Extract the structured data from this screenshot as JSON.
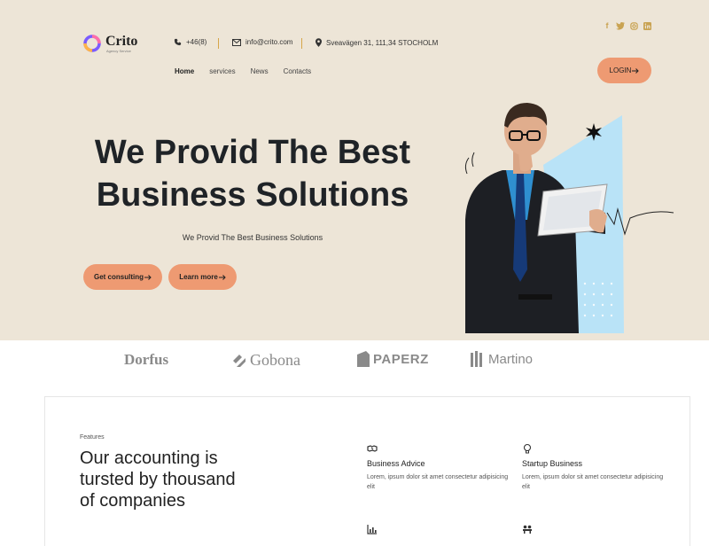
{
  "brand": {
    "name": "Crito",
    "tagline": "Agency Service"
  },
  "contact": {
    "phone": "+46(8)",
    "email": "info@crito.com",
    "address": "Sveavägen 31, 111,34 STOCHOLM"
  },
  "social": [
    {
      "name": "facebook",
      "glyph": "f"
    },
    {
      "name": "twitter",
      "glyph": "t"
    },
    {
      "name": "instagram",
      "glyph": "◎"
    },
    {
      "name": "linkedin",
      "glyph": "in"
    }
  ],
  "nav": {
    "items": [
      "Home",
      "services",
      "News",
      "Contacts"
    ]
  },
  "login_label": "LOGIN",
  "hero": {
    "headline_line1": "We Provid The Best",
    "headline_line2": "Business Solutions",
    "subtitle": "We Provid The Best Business Solutions",
    "primary_button": "Get consulting",
    "secondary_button": "Learn more"
  },
  "brands": [
    "Dorfus",
    "Gobona",
    "PAPERZ",
    "Martino"
  ],
  "features": {
    "label": "Features",
    "title": "Our accounting is tursted by thousand of companies",
    "items": [
      {
        "title": "Business Advice",
        "text": "Lorem, ipsum dolor sit amet consectetur adipisicing elit"
      },
      {
        "title": "Startup Business",
        "text": "Lorem, ipsum dolor sit amet consectetur adipisicing elit"
      }
    ]
  },
  "colors": {
    "hero_bg": "#ede5d7",
    "accent": "#ee9a72",
    "gold": "#c9a352",
    "light_blue": "#b9e3f7"
  }
}
